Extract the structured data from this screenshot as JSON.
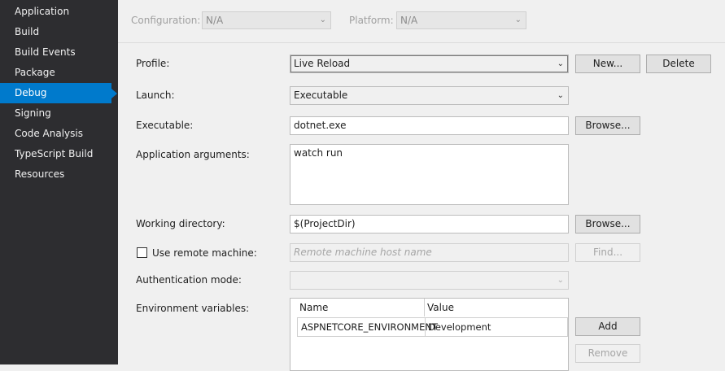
{
  "sidebar": {
    "items": [
      {
        "label": "Application"
      },
      {
        "label": "Build"
      },
      {
        "label": "Build Events"
      },
      {
        "label": "Package"
      },
      {
        "label": "Debug"
      },
      {
        "label": "Signing"
      },
      {
        "label": "Code Analysis"
      },
      {
        "label": "TypeScript Build"
      },
      {
        "label": "Resources"
      }
    ],
    "active": "Debug"
  },
  "topbar": {
    "configuration_label": "Configuration:",
    "configuration_value": "N/A",
    "platform_label": "Platform:",
    "platform_value": "N/A"
  },
  "form": {
    "profile_label": "Profile:",
    "profile_value": "Live Reload",
    "new_button": "New...",
    "delete_button": "Delete",
    "launch_label": "Launch:",
    "launch_value": "Executable",
    "executable_label": "Executable:",
    "executable_value": "dotnet.exe",
    "browse_button": "Browse...",
    "app_args_label": "Application arguments:",
    "app_args_value": "watch run",
    "working_dir_label": "Working directory:",
    "working_dir_value": "$(ProjectDir)",
    "browse_button_2": "Browse...",
    "remote_label": "Use remote machine:",
    "remote_placeholder": "Remote machine host name",
    "find_button": "Find...",
    "auth_label": "Authentication mode:",
    "env_label": "Environment variables:",
    "add_button": "Add",
    "remove_button": "Remove"
  },
  "env_grid": {
    "headers": [
      "Name",
      "Value"
    ],
    "rows": [
      {
        "name": "ASPNETCORE_ENVIRONMENT",
        "value": "Development"
      }
    ]
  },
  "colors": {
    "sidebar_bg": "#2d2d30",
    "active": "#007acc"
  }
}
